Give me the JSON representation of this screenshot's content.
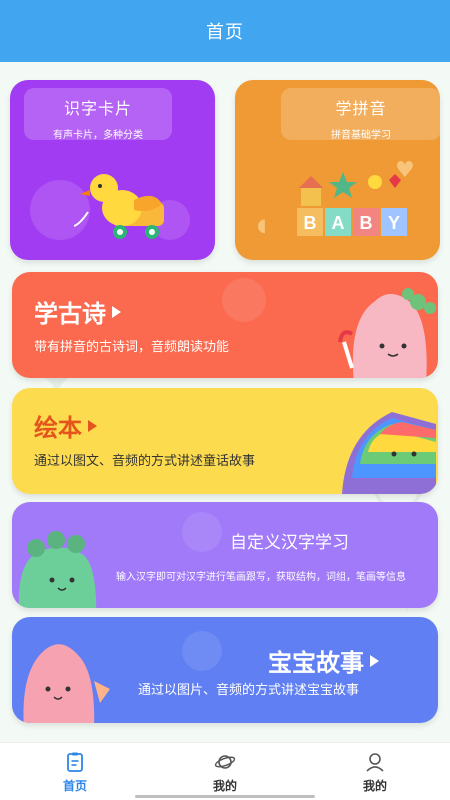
{
  "header": {
    "title": "首页"
  },
  "tiles": [
    {
      "title": "识字卡片",
      "subtitle": "有声卡片，多种分类",
      "color": "#a23cf2"
    },
    {
      "title": "学拼音",
      "subtitle": "拼音基础学习",
      "color": "#ef9a35",
      "block_letters": [
        "B",
        "A",
        "B",
        "Y"
      ]
    }
  ],
  "banners": [
    {
      "title": "学古诗",
      "subtitle": "带有拼音的古诗词，音频朗读功能",
      "color": "#fb694e"
    },
    {
      "title": "绘本",
      "subtitle": "通过以图文、音频的方式讲述童话故事",
      "color": "#fddb4e"
    },
    {
      "title": "自定义汉字学习",
      "subtitle": "输入汉字即可对汉字进行笔画跟写，获取结构，词组，笔画等信息",
      "color": "#a07af8"
    },
    {
      "title": "宝宝故事",
      "subtitle": "通过以图片、音频的方式讲述宝宝故事",
      "color": "#5f7ff3"
    }
  ],
  "tabbar": {
    "items": [
      {
        "label": "首页",
        "icon": "clipboard-icon",
        "active": true
      },
      {
        "label": "我的",
        "icon": "planet-icon",
        "active": false
      },
      {
        "label": "我的",
        "icon": "user-icon",
        "active": false
      }
    ],
    "active_color": "#2c86e8"
  }
}
